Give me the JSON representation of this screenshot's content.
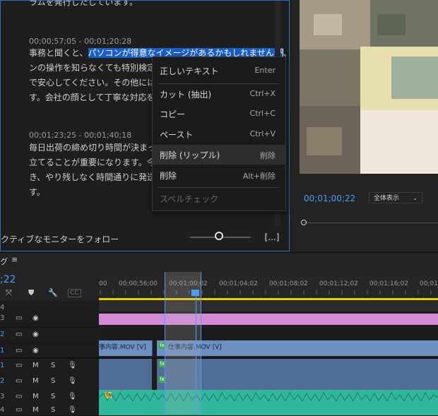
{
  "transcript": {
    "top_line": "ラムを発行したしています。",
    "seg1_time": "00;00;57;05 - 00;01;20;28",
    "seg1_line1_pre": "事務と聞くと、",
    "seg1_line1_hl": "パソコンが得意なイメージがあるかもしれませんが",
    "seg1_line1_post": "、パソコ",
    "seg1_line2": "ンの操作を知らなくても特別検定を",
    "seg1_line3": "で安心してください。その他には電話",
    "seg1_line4": "す。会社の顔として丁寧な対応を一",
    "seg2_time": "00;01;23;25 - 00;01;40;18",
    "seg2_line1": "毎日出荷の締め切り時間が決まって",
    "seg2_line2": "立てることが重要になります。今日、",
    "seg2_line3": "き、やり残しなく時間通りに発送手配",
    "seg2_line4": "す。",
    "follow_label": "クティブなモニターをフォロー",
    "more_label": "[...]"
  },
  "context_menu": {
    "items": [
      {
        "label": "正しいテキスト",
        "shortcut": "Enter"
      },
      {
        "label": "カット (抽出)",
        "shortcut": "Ctrl+X"
      },
      {
        "label": "コピー",
        "shortcut": "Ctrl+C"
      },
      {
        "label": "ペースト",
        "shortcut": "Ctrl+V"
      },
      {
        "label": "削除 (リップル)",
        "shortcut": "削除"
      },
      {
        "label": "削除",
        "shortcut": "Alt+削除"
      },
      {
        "label": "スペルチェック",
        "shortcut": ""
      }
    ]
  },
  "monitor": {
    "timecode": "00;01;00;22",
    "zoom": "全体表示"
  },
  "timeline": {
    "title": "グ",
    "menu_icon": "≡",
    "timecode": ";22",
    "ruler": [
      "00",
      "00;00;56;00",
      "00;01;00;02",
      "00;01;04;02",
      "00;01;08;02",
      "00;01;12;02",
      "00;01;16;02",
      "00;01"
    ],
    "tracks": [
      {
        "id": "4",
        "kind": "video"
      },
      {
        "id": "3",
        "kind": "video"
      },
      {
        "id": "2",
        "kind": "video"
      },
      {
        "id": "1",
        "kind": "video"
      },
      {
        "id": "1",
        "kind": "audio"
      },
      {
        "id": "2",
        "kind": "audio"
      },
      {
        "id": "3",
        "kind": "audio"
      },
      {
        "id": "4",
        "kind": "audio"
      }
    ],
    "clip_v1_a": "事内容.MOV [V]",
    "clip_v1_b": "仕事内容.MOV [V]",
    "fx_badge": "fx",
    "mute_label": "M",
    "solo_label": "S"
  },
  "colors": {
    "accent": "#4a9ff5",
    "selection": "#1a5ec8",
    "pink_clip": "#d58ad8",
    "video_clip": "#6d8fc2",
    "audio_clip": "#2fb89c"
  }
}
